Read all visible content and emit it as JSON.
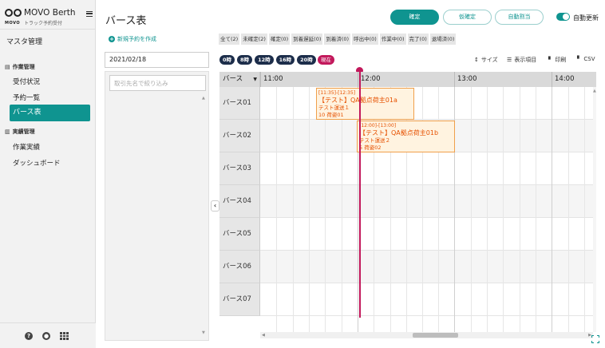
{
  "sidebar": {
    "logo_title": "MOVO Berth",
    "logo_sub": "トラック予約受付",
    "logo_small": "MOVO",
    "master": "マスタ管理",
    "section_work": "作業管理",
    "items_work": [
      "受付状況",
      "予約一覧",
      "バース表"
    ],
    "section_results": "実績管理",
    "items_results": [
      "作業実績",
      "ダッシュボード"
    ]
  },
  "header": {
    "title": "バース表",
    "btn_confirm": "確定",
    "btn_tentative": "仮確定",
    "btn_auto_assign": "自動割当",
    "auto_update_label": "自動更新"
  },
  "left": {
    "new_reservation": "新規予約を作成",
    "date": "2021/02/18",
    "search_placeholder": "取引先名で絞り込み"
  },
  "filters": [
    "全て(2)",
    "未確定(2)",
    "確定(0)",
    "到着遅延(0)",
    "到着済(0)",
    "呼出中(0)",
    "作業中(0)",
    "完了(0)",
    "退場済(0)"
  ],
  "hour_buttons": [
    "0時",
    "8時",
    "12時",
    "16時",
    "20時"
  ],
  "now_button": "現在",
  "tools": {
    "size": "サイズ",
    "columns": "表示項目",
    "print": "印刷",
    "csv": "CSV"
  },
  "timeline": {
    "berth_header": "バース",
    "hours": [
      "11:00",
      "12:00",
      "13:00",
      "14:00"
    ],
    "berths": [
      "バース01",
      "バース02",
      "バース03",
      "バース04",
      "バース05",
      "バース06",
      "バース07"
    ],
    "reservations": [
      {
        "time": "[11:35]-[12:35]",
        "title": "【テスト】QA拠点荷主01a",
        "line1": "テスト運送１",
        "line2": "10 荷姿01"
      },
      {
        "time": "[12:00]-[13:00]",
        "title": "【テスト】QA拠点荷主01b",
        "line1": "テスト運送２",
        "line2": "5 荷姿02"
      }
    ]
  },
  "colors": {
    "accent": "#0f9490",
    "now": "#c2185b",
    "block_border": "#f0a04b",
    "block_text": "#e65100"
  }
}
